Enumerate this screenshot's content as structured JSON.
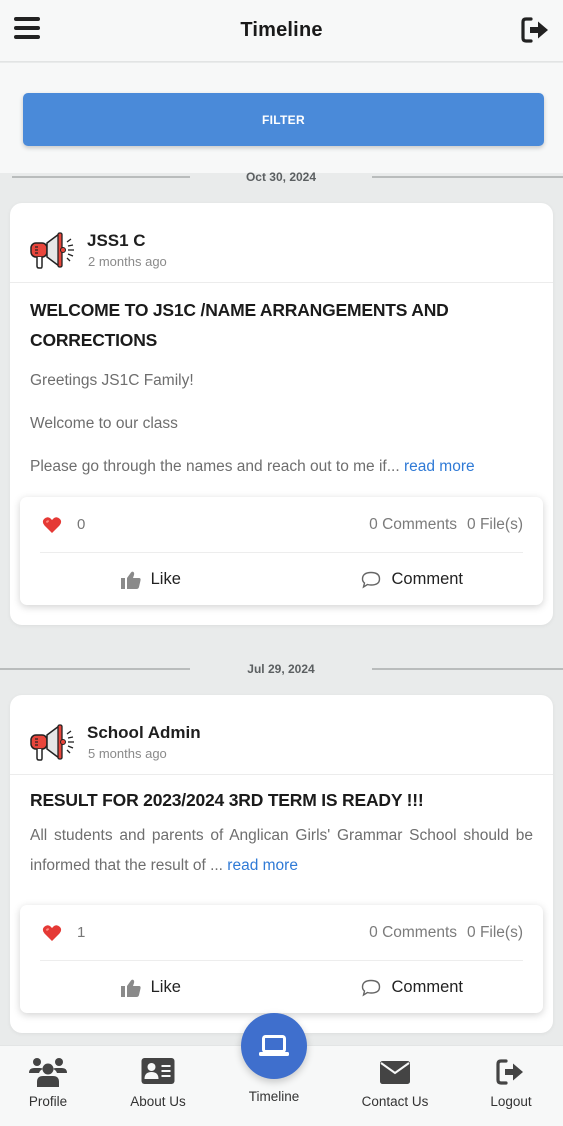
{
  "header": {
    "title": "Timeline",
    "menu_icon": "hamburger-menu-icon",
    "logout_icon": "sign-out-icon"
  },
  "filter": {
    "label": "FILTER"
  },
  "posts": [
    {
      "date": "Oct 30, 2024",
      "author": "JSS1 C",
      "time_ago": "2 months ago",
      "avatar_icon": "megaphone-icon",
      "title": "WELCOME TO JS1C /NAME ARRANGEMENTS AND CORRECTIONS",
      "paragraphs": [
        "Greetings JS1C Family!",
        "Welcome to our class",
        "Please go through the names and reach out to me if... "
      ],
      "read_more": "read more",
      "likes": "0",
      "comments": "0 Comments",
      "files": "0 File(s)",
      "like_label": "Like",
      "comment_label": "Comment"
    },
    {
      "date": "Jul 29, 2024",
      "author": "School Admin",
      "time_ago": "5 months ago",
      "avatar_icon": "megaphone-icon",
      "title": "RESULT FOR 2023/2024 3RD TERM IS READY !!!",
      "paragraphs": [
        "All students and parents of Anglican Girls' Grammar School should be informed that the result of ... "
      ],
      "read_more": "read more",
      "likes": "1",
      "comments": "0 Comments",
      "files": "0 File(s)",
      "like_label": "Like",
      "comment_label": "Comment"
    }
  ],
  "bottom_nav": {
    "items": [
      {
        "label": "Profile",
        "icon": "users-icon"
      },
      {
        "label": "About Us",
        "icon": "id-card-icon"
      },
      {
        "label": "Timeline",
        "icon": "laptop-icon",
        "active": true
      },
      {
        "label": "Contact Us",
        "icon": "envelope-icon"
      },
      {
        "label": "Logout",
        "icon": "sign-out-icon"
      }
    ]
  },
  "colors": {
    "accent": "#4a8ad9",
    "fab": "#3f6fcd",
    "link": "#2f7ad6",
    "heart": "#e53935",
    "megaphone_red": "#e8463c"
  }
}
